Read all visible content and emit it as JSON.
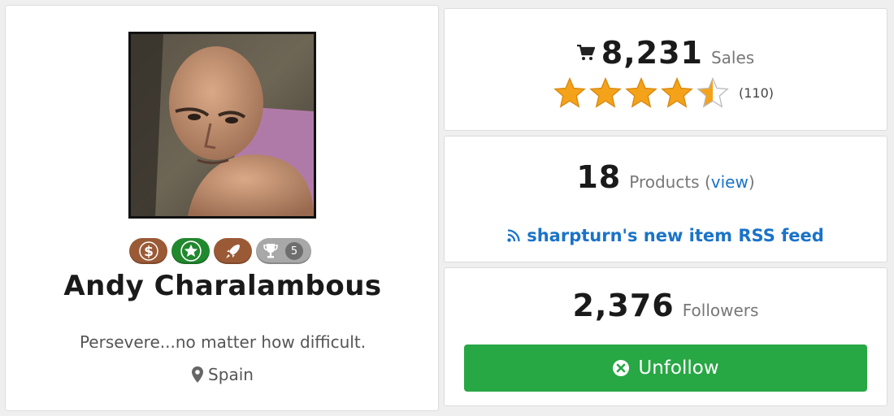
{
  "profile": {
    "name": "Andy Charalambous",
    "tagline": "Persevere...no matter how difficult.",
    "location": "Spain",
    "avatar_icon": "user-photo",
    "badges": [
      {
        "icon": "dollar-icon",
        "color": "#9b5a36"
      },
      {
        "icon": "star-icon",
        "color": "#21882e"
      },
      {
        "icon": "rocket-icon",
        "color": "#9b5a36"
      },
      {
        "icon": "trophy-icon",
        "color": "#a8a8a8",
        "count": "5"
      }
    ]
  },
  "sales": {
    "value": "8,231",
    "label": "Sales",
    "rating": 4.5,
    "rating_max": 5,
    "rating_count": "(110)"
  },
  "products": {
    "value": "18",
    "label": "Products (",
    "link_label": "view",
    "label_close": ")",
    "rss_label": "sharpturn's new item RSS feed"
  },
  "followers": {
    "value": "2,376",
    "label": "Followers",
    "button_label": "Unfollow"
  },
  "colors": {
    "accent_link": "#1a73c8",
    "button_green": "#28a745",
    "star": "#f4a21a"
  }
}
